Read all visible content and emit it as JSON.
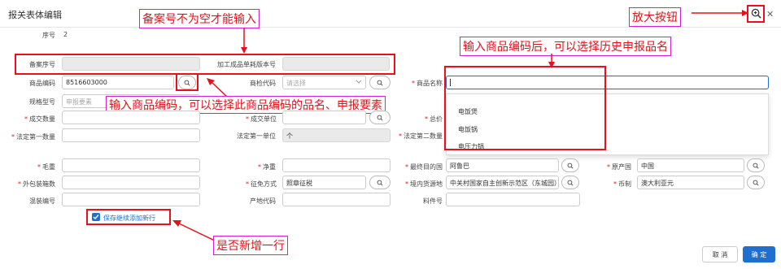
{
  "dialog": {
    "title": "报关表体编辑"
  },
  "labels": {
    "seq": "序号",
    "seq_value": "2",
    "filing_seq": "备案序号",
    "processed_version": "加工成品单耗版本号",
    "goods_code": "商品编码",
    "goods_code_value": "8516603000",
    "inspection_code": "商检代码",
    "inspection_placeholder": "请选择",
    "goods_name": "商品名称",
    "spec_model": "规格型号",
    "spec_placeholder": "申报要素",
    "deal_qty": "成交数量",
    "deal_unit": "成交单位",
    "total_price": "总价",
    "legal_first_qty": "法定第一数量",
    "legal_first_unit": "法定第一单位",
    "legal_first_unit_value": "个",
    "legal_second_qty": "法定第二数量",
    "gross_weight": "毛重",
    "net_weight": "净重",
    "destination_country": "最终目的国",
    "destination_value": "阿鲁巴",
    "origin_country": "原产国",
    "origin_value": "中国",
    "outer_pkg_count": "外包装箱数",
    "tax_mode": "征免方式",
    "tax_mode_value": "照章征税",
    "domestic_source": "境内货源地",
    "domestic_source_value": "中关村国家自主创新示范区（东城园）",
    "currency": "币制",
    "currency_value": "澳大利亚元",
    "mixed_code": "混装编号",
    "origin_area_code": "产地代码",
    "part_no": "料件号",
    "continue_add": "保存继续添加新行"
  },
  "dropdown": {
    "items": [
      "电饭煲",
      "电饭锅",
      "电压力锅"
    ]
  },
  "buttons": {
    "cancel": "取 消",
    "confirm": "确 定"
  },
  "annotations": {
    "filing_required": "备案号不为空才能输入",
    "zoom_button": "放大按钮",
    "history_name": "输入商品编码后，可以选择历史申报品名",
    "code_select": "输入商品编码，可以选择此商品编码的品名、申报要素",
    "new_line": "是否新增一行"
  },
  "colors": {
    "annotation_red": "#e8101a",
    "primary": "#1e6fd0",
    "checkbox_blue": "#1e6fd0"
  }
}
